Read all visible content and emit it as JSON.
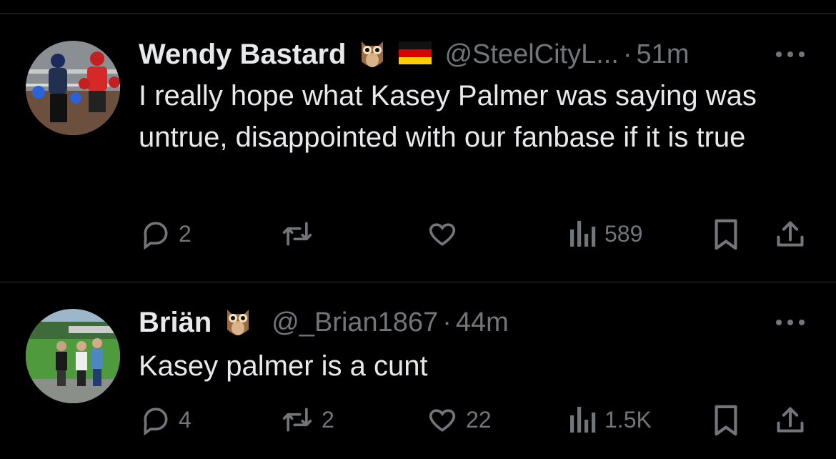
{
  "tweets": [
    {
      "display_name": "Wendy Bastard",
      "handle": "@SteelCityL...",
      "separator": "·",
      "time": "51m",
      "text": "I really hope what Kasey Palmer was saying was untrue, disappointed with our fanbase if it is true",
      "badges": [
        "owl-emoji",
        "germany-flag-emoji"
      ],
      "counts": {
        "replies": "2",
        "retweets": "",
        "likes": "",
        "views": "589"
      }
    },
    {
      "display_name": "Briän",
      "handle": "@_Brian1867",
      "separator": "·",
      "time": "44m",
      "text": "Kasey palmer is a cunt",
      "badges": [
        "owl-emoji"
      ],
      "counts": {
        "replies": "4",
        "retweets": "2",
        "likes": "22",
        "views": "1.5K"
      }
    }
  ],
  "colors": {
    "background": "#000000",
    "text": "#e7e9ea",
    "muted": "#71767b",
    "divider": "#2f3336"
  }
}
